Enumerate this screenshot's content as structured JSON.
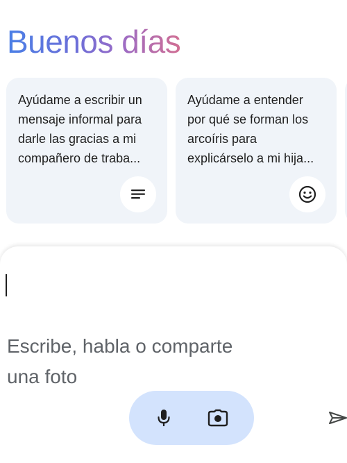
{
  "greeting": {
    "text": "Buenos días"
  },
  "suggestions": [
    {
      "text": "Ayúdame a escribir un\nmensaje informal para\ndarle las gracias a mi\ncompañero de traba...",
      "icon": "notes-lines-icon"
    },
    {
      "text": "Ayúdame a entender\npor qué se forman los\narcoíris para\nexplicárselo a mi hija...",
      "icon": "smiley-face-icon"
    }
  ],
  "composer": {
    "placeholder": "Escribe, habla o comparte\nuna foto",
    "mic_icon": "microphone-icon",
    "camera_icon": "camera-icon",
    "send_icon": "send-icon"
  },
  "colors": {
    "card_background": "#f0f4f9",
    "pill_background": "#d3e3fd",
    "greeting_gradient_start": "#4a7fe6",
    "greeting_gradient_end": "#d16f93"
  }
}
